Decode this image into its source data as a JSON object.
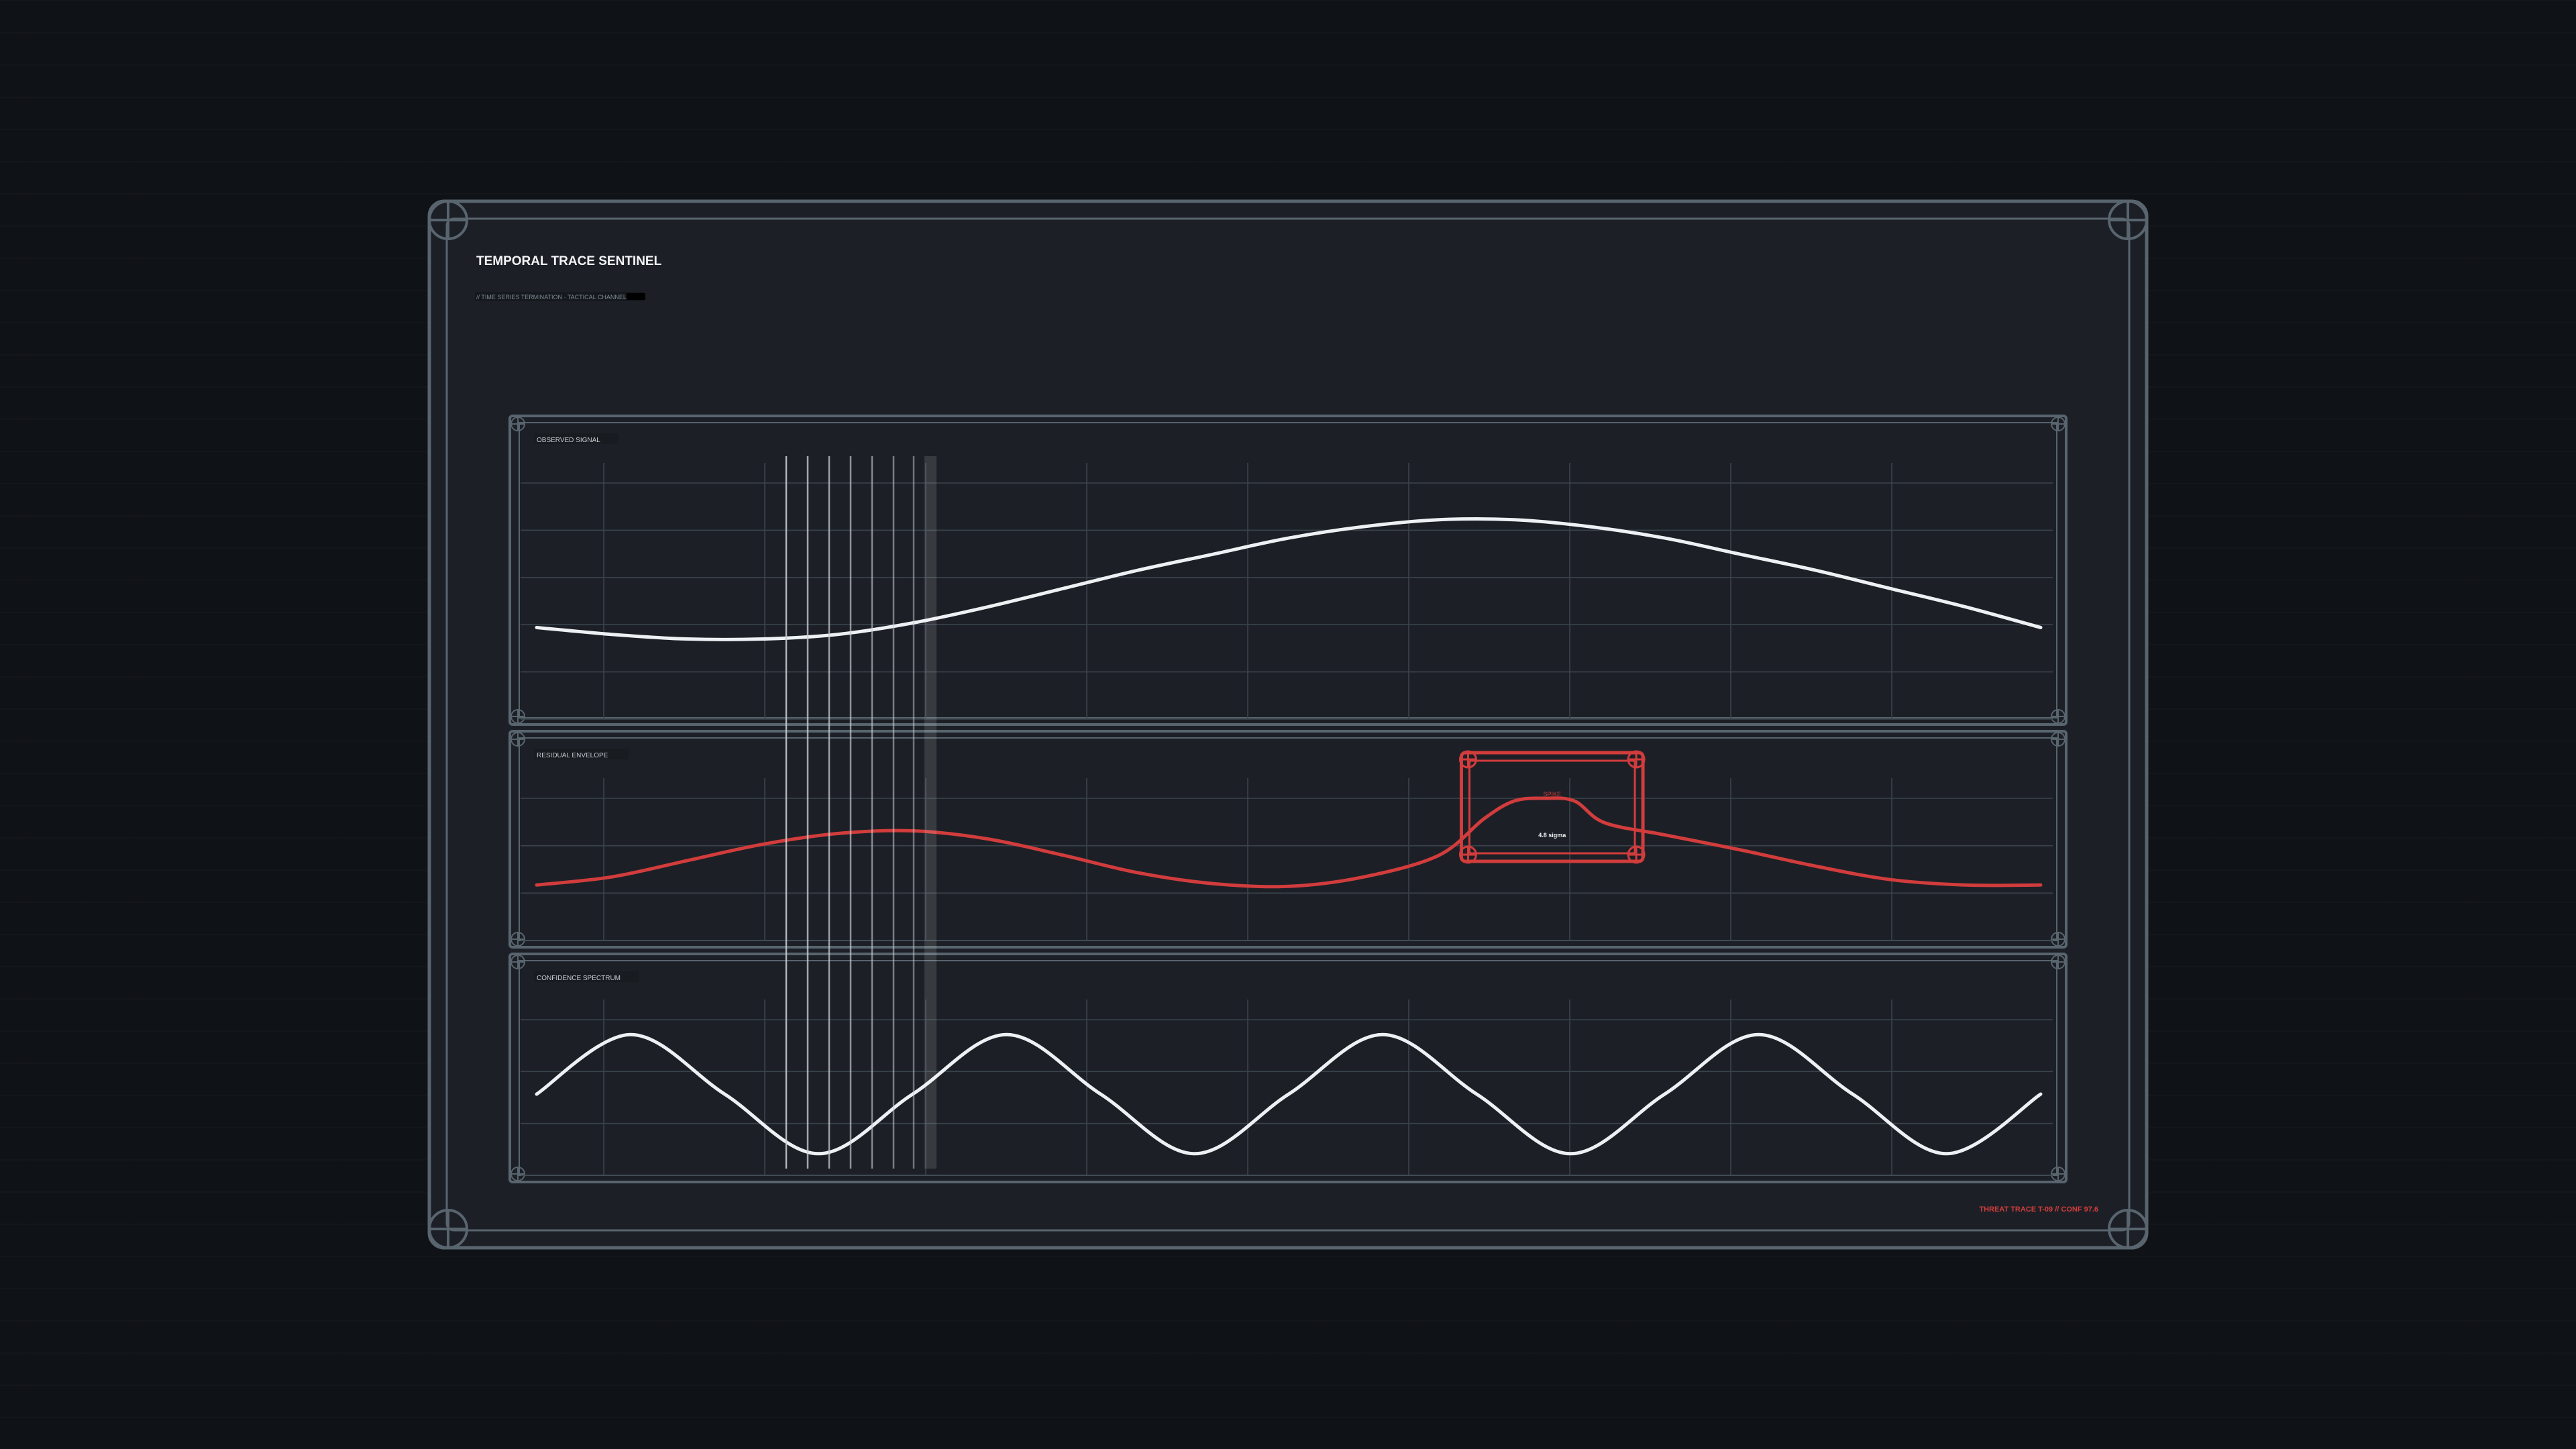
{
  "header": {
    "title": "TEMPORAL TRACE SENTINEL",
    "subtitle": "// TIME SERIES TERMINATION · TACTICAL CHANNEL"
  },
  "footer": {
    "status": "THREAT TRACE T-09 // CONF 97.6"
  },
  "colors": {
    "background": "#0f1216",
    "panel": "#1c2026",
    "frame": "#58646e",
    "grid": "#3a434c",
    "signal": "#eef1f4",
    "alert": "#d23c3c",
    "cursor": "#ffffff"
  },
  "chart_data": [
    {
      "type": "line",
      "title": "OBSERVED SIGNAL",
      "series": [
        {
          "x": [
            0,
            0.05,
            0.1,
            0.15,
            0.2,
            0.25,
            0.3,
            0.35,
            0.4,
            0.45,
            0.5,
            0.55,
            0.6,
            0.65,
            0.7,
            0.75,
            0.8,
            0.85,
            0.9,
            0.95,
            1.0
          ],
          "values": [
            0.63,
            0.66,
            0.68,
            0.68,
            0.66,
            0.61,
            0.54,
            0.46,
            0.38,
            0.31,
            0.24,
            0.19,
            0.16,
            0.16,
            0.19,
            0.24,
            0.31,
            0.38,
            0.46,
            0.54,
            0.63
          ]
        }
      ],
      "ylim": [
        1,
        0
      ],
      "grid": true
    },
    {
      "type": "line",
      "title": "RESIDUAL ENVELOPE",
      "series": [
        {
          "x": [
            0,
            0.05,
            0.1,
            0.15,
            0.2,
            0.25,
            0.3,
            0.35,
            0.4,
            0.45,
            0.5,
            0.55,
            0.6,
            0.63,
            0.65,
            0.67,
            0.69,
            0.71,
            0.75,
            0.8,
            0.85,
            0.9,
            0.95,
            1.0
          ],
          "values": [
            0.64,
            0.58,
            0.46,
            0.34,
            0.26,
            0.24,
            0.3,
            0.42,
            0.55,
            0.63,
            0.65,
            0.58,
            0.42,
            0.15,
            0.02,
            0.0,
            0.02,
            0.18,
            0.27,
            0.38,
            0.5,
            0.6,
            0.64,
            0.64
          ]
        }
      ],
      "ylim": [
        1,
        0
      ],
      "grid": true,
      "annotation": {
        "label": "SPIKE",
        "value": "4.8 sigma",
        "x_from": 0.63,
        "x_to": 0.74
      }
    },
    {
      "type": "line",
      "title": "CONFIDENCE SPECTRUM",
      "series": [
        {
          "x": [
            0,
            0.0625,
            0.125,
            0.1875,
            0.25,
            0.3125,
            0.375,
            0.4375,
            0.5,
            0.5625,
            0.625,
            0.6875,
            0.75,
            0.8125,
            0.875,
            0.9375,
            1.0
          ],
          "values": [
            0.5,
            0.1,
            0.5,
            0.9,
            0.5,
            0.1,
            0.5,
            0.9,
            0.5,
            0.1,
            0.5,
            0.9,
            0.5,
            0.1,
            0.5,
            0.9,
            0.5
          ]
        }
      ],
      "ylim": [
        1,
        0
      ],
      "grid": true
    }
  ]
}
